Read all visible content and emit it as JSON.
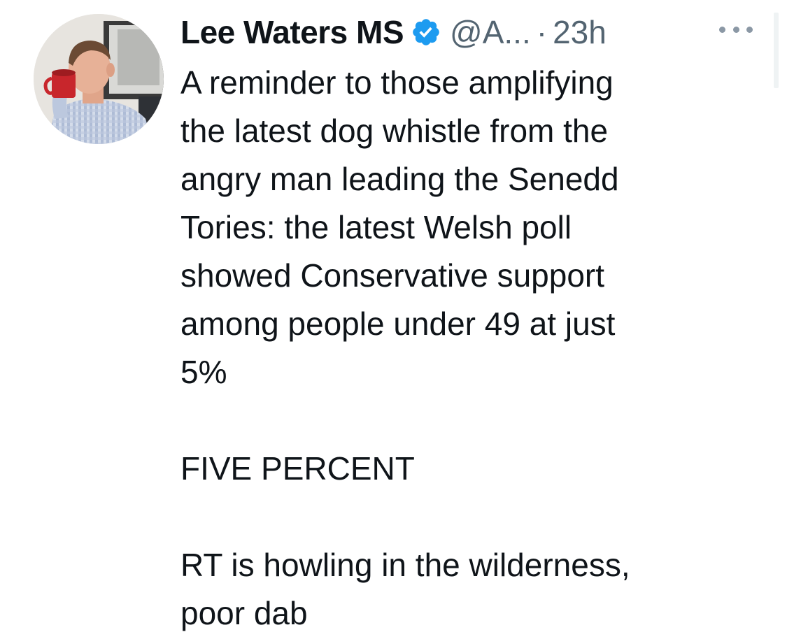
{
  "tweet": {
    "author_name": "Lee Waters MS",
    "handle": "@A...",
    "separator": "·",
    "time": "23h",
    "verified_icon": "verified-badge-icon",
    "more_icon": "more-dots-icon",
    "paragraphs": [
      [
        "A reminder to those amplifying",
        "the latest dog whistle from the",
        "angry man leading the Senedd",
        "Tories: the latest Welsh poll",
        "showed Conservative support",
        "among people under 49 at just",
        "5%"
      ],
      [
        "FIVE PERCENT"
      ],
      [
        "RT is howling in the wilderness,",
        "poor dab"
      ]
    ]
  },
  "colors": {
    "text": "#0f1419",
    "secondary": "#536471",
    "verified": "#1d9bf0"
  }
}
